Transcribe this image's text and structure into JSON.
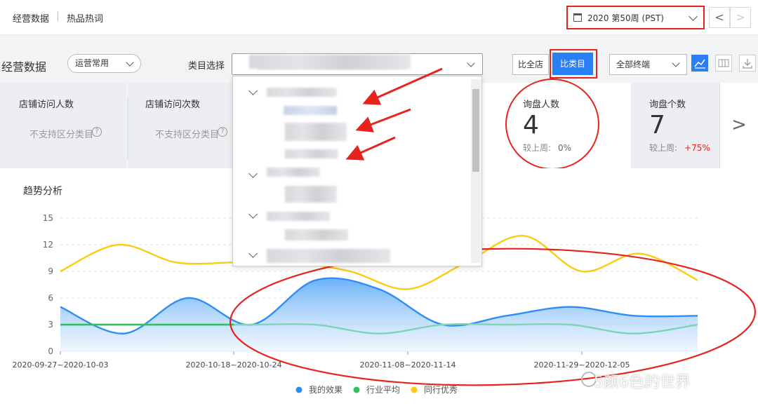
{
  "header": {
    "crumbs": [
      "经营数据",
      "热品热词"
    ],
    "week": "2020 第50周 (PST)",
    "prev": "<",
    "next": ">"
  },
  "toolbar": {
    "section_title": "经营数据",
    "view_select": "运营常用",
    "category_label": "类目选择",
    "compare_all": "比全店",
    "compare_category": "比类目",
    "terminal_select": "全部终端"
  },
  "cards": [
    {
      "label": "店铺访问人数",
      "note": "不支持区分类目"
    },
    {
      "label": "店铺访问次数",
      "note": "不支持区分类目"
    },
    {
      "label": "询盘人数",
      "value": "4",
      "compare_label": "较上周:",
      "compare_value": "0%"
    },
    {
      "label": "询盘个数",
      "value": "7",
      "compare_label": "较上周:",
      "compare_value": "+75%"
    }
  ],
  "cards_next": ">",
  "trend": {
    "title": "趋势分析"
  },
  "watermark": "5颜6色的世界",
  "colors": {
    "accent": "#2b7ff5",
    "annotation": "#e8231e",
    "mine": "#2f8ef5",
    "industry": "#2fc25b",
    "peer": "#facc14"
  },
  "chart_data": {
    "type": "line",
    "y_ticks": [
      "0",
      "3",
      "6",
      "9",
      "12",
      "15"
    ],
    "ylim": [
      0,
      15
    ],
    "x_tick_labels": [
      "2020-09-27~2020-10-03",
      "2020-10-18~2020-10-24",
      "2020-11-08~2020-11-14",
      "2020-11-29~2020-12-05"
    ],
    "legend": [
      "我的效果",
      "行业平均",
      "同行优秀"
    ],
    "series": [
      {
        "name": "我的效果",
        "color": "#2f8ef5",
        "area": true,
        "values": [
          5,
          2,
          6,
          3,
          8,
          7,
          3,
          4,
          5,
          4,
          4
        ]
      },
      {
        "name": "行业平均",
        "color": "#2fc25b",
        "values": [
          3,
          3,
          3,
          3,
          3,
          2,
          3,
          3,
          3,
          2,
          3
        ]
      },
      {
        "name": "行业平均 (area)",
        "color": "#7ed4b6",
        "values": [
          3,
          3,
          3,
          3,
          3,
          2,
          3,
          3,
          3,
          2,
          3
        ]
      },
      {
        "name": "同行优秀",
        "color": "#facc14",
        "values": [
          9,
          12,
          10,
          10,
          10,
          9,
          7,
          10,
          13,
          9,
          11,
          8
        ]
      }
    ]
  }
}
